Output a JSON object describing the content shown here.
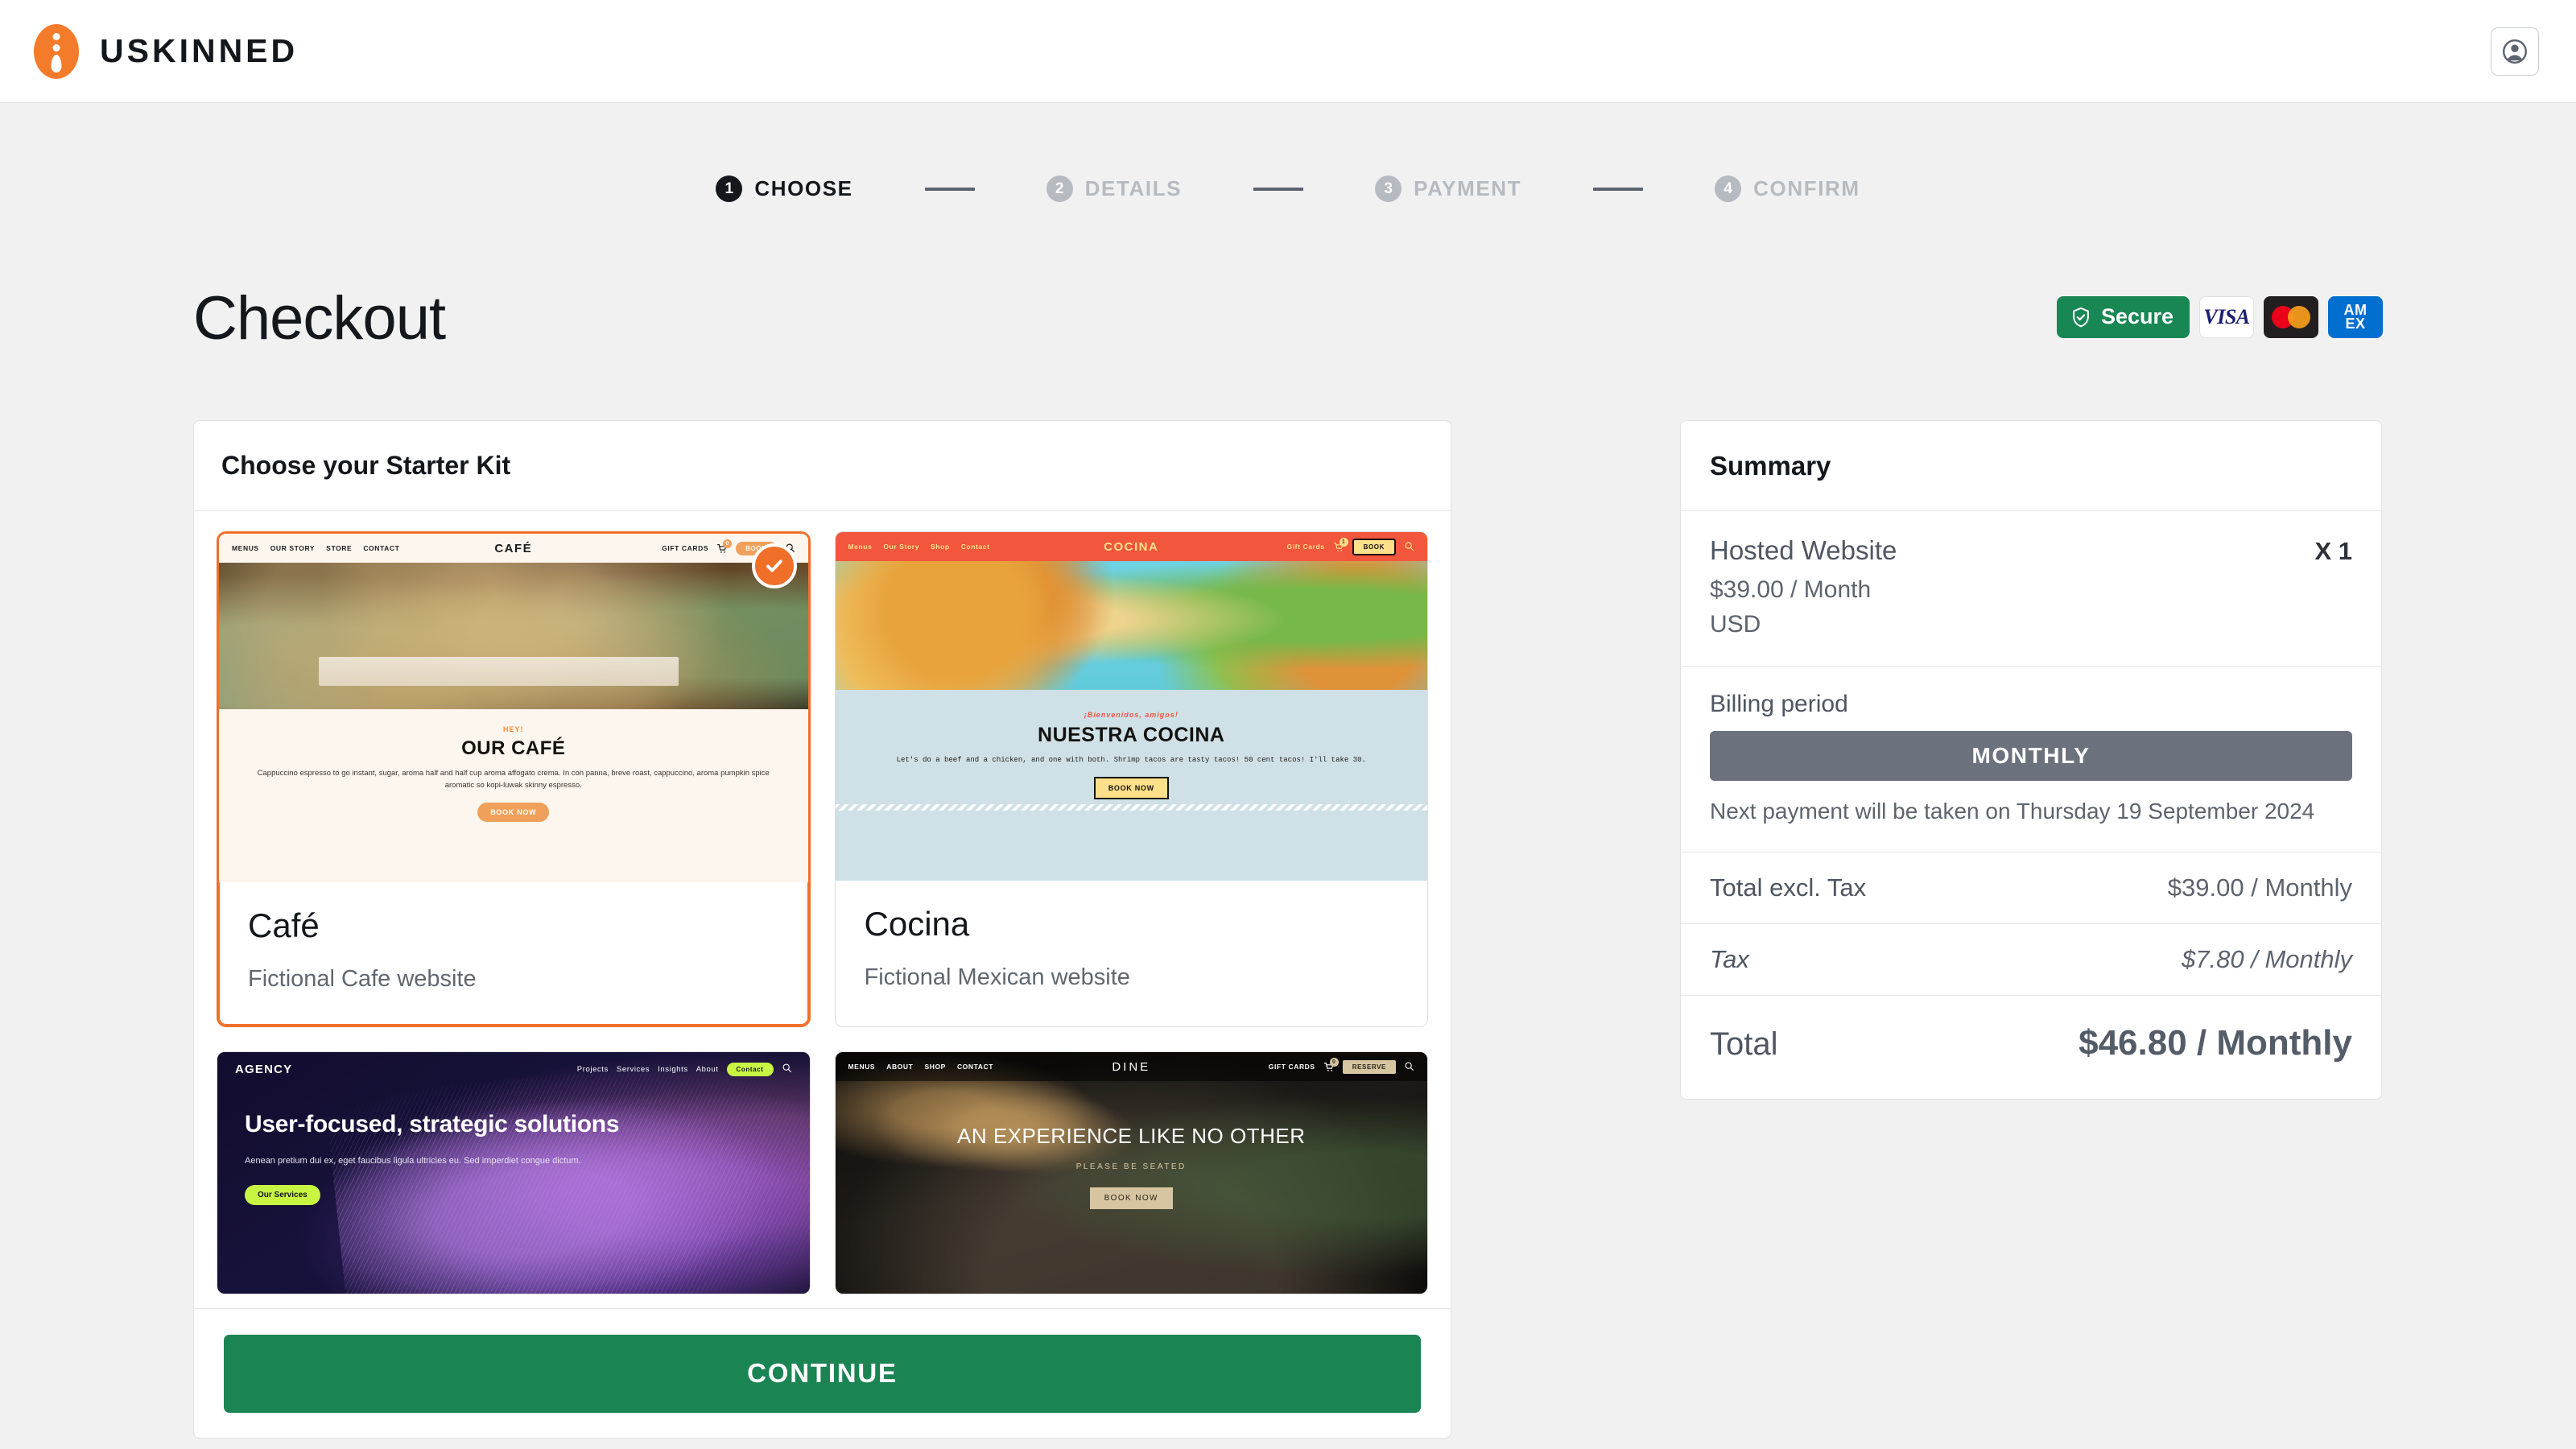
{
  "header": {
    "brand_name": "USKINNED",
    "brand_icon": "uskinned-drop-logo",
    "account_icon": "account-person-icon"
  },
  "stepper": {
    "steps": [
      {
        "num": "1",
        "label": "CHOOSE",
        "state": "active"
      },
      {
        "num": "2",
        "label": "DETAILS",
        "state": "idle"
      },
      {
        "num": "3",
        "label": "PAYMENT",
        "state": "idle"
      },
      {
        "num": "4",
        "label": "CONFIRM",
        "state": "idle"
      }
    ]
  },
  "page": {
    "title": "Checkout"
  },
  "badges": {
    "secure_label": "Secure",
    "secure_icon": "shield-check-icon",
    "visa_label": "VISA",
    "mastercard_icon": "mastercard-circles-icon",
    "amex_line1": "AM",
    "amex_line2": "EX",
    "secure_color": "#188754",
    "visa_color": "#1a1f71",
    "amex_color": "#006fcf"
  },
  "kits_panel": {
    "heading": "Choose your Starter Kit",
    "continue_label": "CONTINUE",
    "continue_color": "#1b8453",
    "selected_accent": "#f0702a",
    "check_icon": "check-circle-icon",
    "items": [
      {
        "name": "Café",
        "description": "Fictional Cafe website",
        "selected": true,
        "preview": {
          "logo": "CAFÉ",
          "nav_left": [
            "MENUS",
            "OUR STORY",
            "STORE",
            "CONTACT"
          ],
          "nav_right_link": "GIFT CARDS",
          "cart_count": "0",
          "cta_nav": "BOOK",
          "search_icon": "search-icon",
          "eyebrow": "HEY!",
          "headline": "OUR CAFÉ",
          "paragraph": "Cappuccino espresso to go instant, sugar, aroma half and half cup aroma affogato crema. In con panna, breve roast, cappuccino, aroma pumpkin spice aromatic so kopi-luwak skinny espresso.",
          "button": "BOOK NOW"
        }
      },
      {
        "name": "Cocina",
        "description": "Fictional Mexican website",
        "selected": false,
        "preview": {
          "logo": "COCINA",
          "nav_left": [
            "Menus",
            "Our Story",
            "Shop",
            "Contact"
          ],
          "nav_right_link": "Gift Cards",
          "cart_count": "1",
          "cta_nav": "BOOK",
          "search_icon": "search-icon",
          "eyebrow": "¡Bienvenidos, amigos!",
          "headline": "NUESTRA COCINA",
          "paragraph": "Let's do a beef and a chicken, and one with both. Shrimp tacos are tasty tacos! 50 cent tacos! I'll take 30.",
          "button": "BOOK NOW"
        }
      },
      {
        "name": "Agency",
        "description": "",
        "selected": false,
        "preview": {
          "logo": "AGENCY",
          "nav_left": [
            "Projects",
            "Services",
            "Insights",
            "About"
          ],
          "nav_right_link": "",
          "cart_count": "",
          "cta_nav": "Contact",
          "search_icon": "search-icon",
          "eyebrow": "",
          "headline": "User-focused, strategic solutions",
          "paragraph": "Aenean pretium dui ex, eget faucibus ligula ultricies eu. Sed imperdiet congue dictum.",
          "button": "Our Services"
        }
      },
      {
        "name": "Dine",
        "description": "",
        "selected": false,
        "preview": {
          "logo": "DINE",
          "nav_left": [
            "MENUS",
            "ABOUT",
            "SHOP",
            "CONTACT"
          ],
          "nav_right_link": "GIFT CARDS",
          "cart_count": "0",
          "cta_nav": "RESERVE",
          "search_icon": "search-icon",
          "eyebrow": "",
          "headline": "AN EXPERIENCE LIKE NO OTHER",
          "paragraph": "PLEASE BE SEATED",
          "button": "BOOK NOW"
        }
      }
    ]
  },
  "summary": {
    "title": "Summary",
    "item_name": "Hosted Website",
    "item_qty": "X 1",
    "item_price": "$39.00 / Month",
    "item_currency": "USD",
    "billing_period_label": "Billing period",
    "billing_period_value": "MONTHLY",
    "next_payment_note": "Next payment will be taken on Thursday 19 September 2024",
    "total_excl_tax_label": "Total excl. Tax",
    "total_excl_tax_value": "$39.00 / Monthly",
    "tax_label": "Tax",
    "tax_value": "$7.80 / Monthly",
    "total_label": "Total",
    "total_value": "$46.80 / Monthly"
  }
}
